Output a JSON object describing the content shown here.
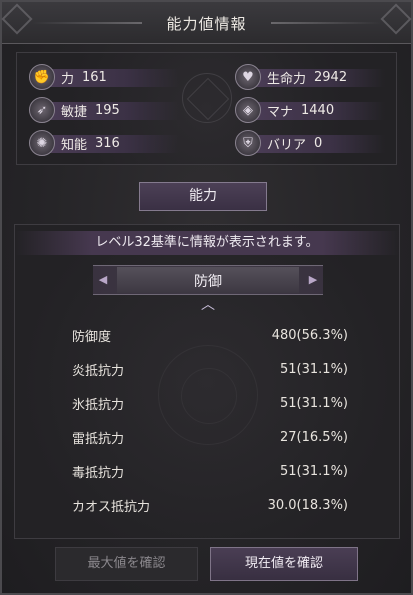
{
  "window": {
    "title": "能力値情報"
  },
  "stats": [
    {
      "icon": "fist-icon",
      "glyph": "✊",
      "label": "力",
      "value": "161"
    },
    {
      "icon": "life-icon",
      "glyph": "♥",
      "label": "生命力",
      "value": "2942"
    },
    {
      "icon": "agility-icon",
      "glyph": "➶",
      "label": "敏捷",
      "value": "195"
    },
    {
      "icon": "mana-icon",
      "glyph": "◈",
      "label": "マナ",
      "value": "1440"
    },
    {
      "icon": "intellect-icon",
      "glyph": "✺",
      "label": "知能",
      "value": "316"
    },
    {
      "icon": "barrier-icon",
      "glyph": "⛨",
      "label": "バリア",
      "value": "0"
    }
  ],
  "ability_tab": "能力",
  "info_text": "レベル32基準に情報が表示されます。",
  "section": {
    "name": "防御",
    "rows": [
      {
        "label": "防御度",
        "value": "480(56.3%)"
      },
      {
        "label": "炎抵抗力",
        "value": "51(31.1%)"
      },
      {
        "label": "氷抵抗力",
        "value": "51(31.1%)"
      },
      {
        "label": "雷抵抗力",
        "value": "27(16.5%)"
      },
      {
        "label": "毒抵抗力",
        "value": "51(31.1%)"
      },
      {
        "label": "カオス抵抗力",
        "value": "30.0(18.3%)"
      }
    ]
  },
  "buttons": {
    "max": "最大値を確認",
    "current": "現在値を確認"
  },
  "colors": {
    "accent": "#4a3e54",
    "accent_border": "#7f7488",
    "disabled_text": "#8b888d"
  }
}
